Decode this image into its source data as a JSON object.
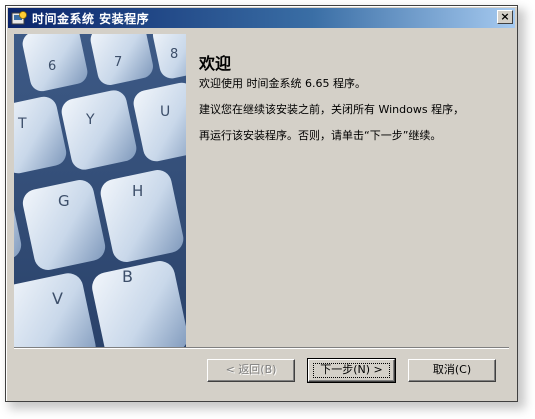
{
  "window": {
    "title": "时间金系统 安装程序",
    "close_glyph": "×"
  },
  "content": {
    "heading": "欢迎",
    "para1": "欢迎使用 时间金系统 6.65 程序。",
    "para2": "建议您在继续该安装之前，关闭所有 Windows 程序，",
    "para3": "再运行该安装程序。否则，请单击“下一步”继续。"
  },
  "buttons": {
    "back": "< 返回(B)",
    "next": "下一步(N) >",
    "cancel": "取消(C)"
  },
  "hero": {
    "description_icon": "keyboard-image",
    "keys": [
      "6",
      "7",
      "8",
      "T",
      "Y",
      "U",
      "G",
      "H",
      "V",
      "B"
    ]
  },
  "colors": {
    "titlebar_start": "#0a246a",
    "titlebar_end": "#a6caf0",
    "dialog_bg": "#d4d0c8"
  }
}
